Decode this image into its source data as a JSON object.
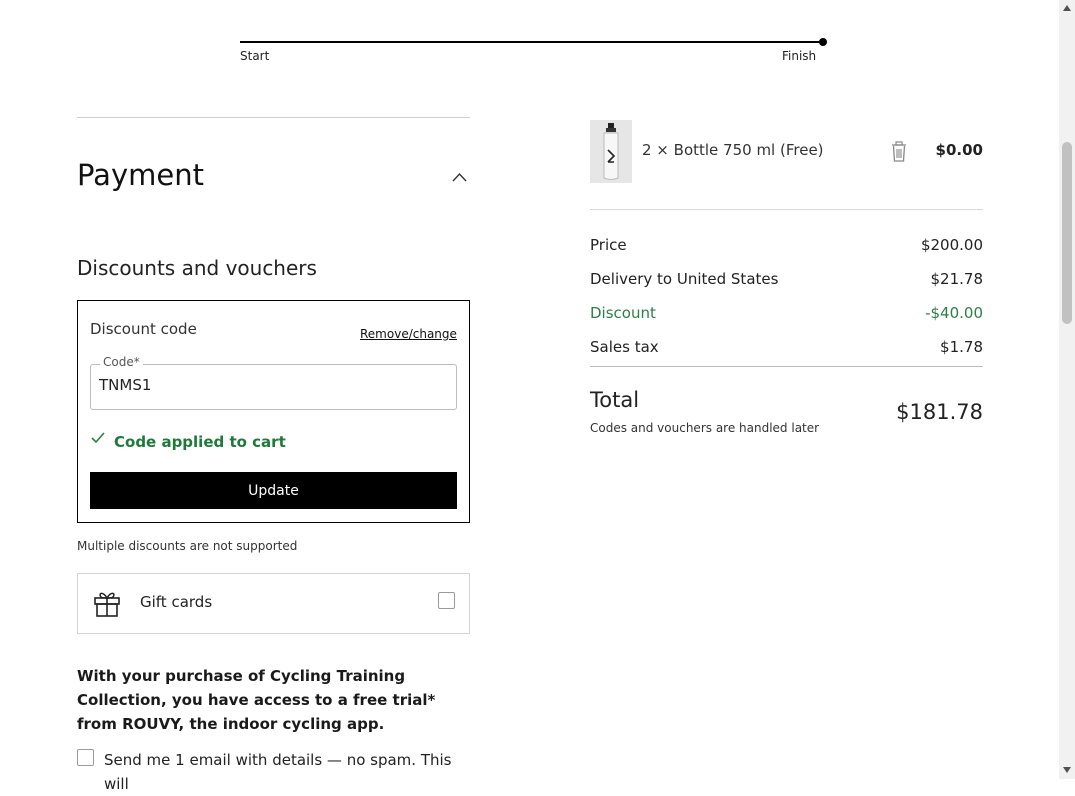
{
  "progress": {
    "start_label": "Start",
    "finish_label": "Finish"
  },
  "payment": {
    "title": "Payment",
    "discounts_heading": "Discounts and vouchers",
    "discount": {
      "label": "Discount code",
      "remove_change": "Remove/change",
      "code_field_label": "Code*",
      "code_value": "TNMS1",
      "applied_message": "Code applied to cart",
      "update_button": "Update"
    },
    "multiple_note": "Multiple discounts are not supported",
    "gift_cards_label": "Gift cards",
    "rouvy_text": "With your purchase of Cycling Training Collection, you have access to a free trial* from ROUVY, the indoor cycling app.",
    "email_opt_in": "Send me 1 email with details — no spam. This will"
  },
  "order": {
    "item": {
      "name": "2 × Bottle 750 ml (Free)",
      "price": "$0.00"
    },
    "summary": [
      {
        "label": "Price",
        "value": "$200.00"
      },
      {
        "label": "Delivery to United States",
        "value": "$21.78"
      },
      {
        "label": "Discount",
        "value": "-$40.00"
      },
      {
        "label": "Sales tax",
        "value": "$1.78"
      }
    ],
    "total": {
      "label": "Total",
      "note": "Codes and vouchers are handled later",
      "value": "$181.78"
    }
  },
  "colors": {
    "accent_green": "#2d7d46",
    "button_black": "#000000"
  },
  "icons": [
    "chevron-up-icon",
    "check-icon",
    "gift-icon",
    "trash-icon",
    "bottle-image"
  ]
}
